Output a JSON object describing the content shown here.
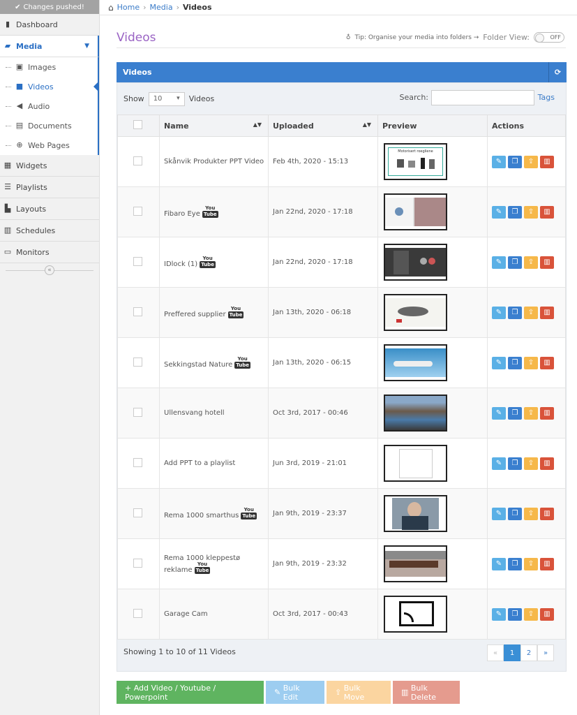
{
  "sidebar": {
    "pushed_label": "Changes pushed!",
    "items": [
      {
        "label": "Dashboard"
      },
      {
        "label": "Media"
      },
      {
        "label": "Widgets"
      },
      {
        "label": "Playlists"
      },
      {
        "label": "Layouts"
      },
      {
        "label": "Schedules"
      },
      {
        "label": "Monitors"
      }
    ],
    "media_sub": [
      {
        "label": "Images"
      },
      {
        "label": "Videos"
      },
      {
        "label": "Audio"
      },
      {
        "label": "Documents"
      },
      {
        "label": "Web Pages"
      }
    ]
  },
  "breadcrumb": {
    "home": "Home",
    "media": "Media",
    "current": "Videos"
  },
  "page": {
    "title": "Videos",
    "tip": "Tip: Organise your media into folders →",
    "folder_view_label": "Folder View:",
    "folder_view_state": "OFF"
  },
  "panel": {
    "title": "Videos",
    "show_label": "Show",
    "page_size": "10",
    "show_suffix": "Videos",
    "search_label": "Search:",
    "tags_link": "Tags",
    "columns": {
      "name": "Name",
      "uploaded": "Uploaded",
      "preview": "Preview",
      "actions": "Actions"
    },
    "rows": [
      {
        "name": "Skånvik Produkter PPT Video",
        "uploaded": "Feb 4th, 2020 - 15:13"
      },
      {
        "name": "Fibaro Eye",
        "uploaded": "Jan 22nd, 2020 - 17:18"
      },
      {
        "name": "IDlock (1)",
        "uploaded": "Jan 22nd, 2020 - 17:18"
      },
      {
        "name": "Preffered supplier",
        "uploaded": "Jan 13th, 2020 - 06:18"
      },
      {
        "name": "Sekkingstad Nature",
        "uploaded": "Jan 13th, 2020 - 06:15"
      },
      {
        "name": "Ullensvang hotell",
        "uploaded": "Oct 3rd, 2017 - 00:46"
      },
      {
        "name": "Add PPT to a playlist",
        "uploaded": "Jun 3rd, 2019 - 21:01"
      },
      {
        "name": "Rema 1000 smarthus",
        "uploaded": "Jan 9th, 2019 - 23:37"
      },
      {
        "name": "Rema 1000 kleppestø reklame",
        "uploaded": "Jan 9th, 2019 - 23:32"
      },
      {
        "name": "Garage Cam",
        "uploaded": "Oct 3rd, 2017 - 00:43"
      }
    ],
    "youtube_you": "You",
    "youtube_tube": "Tube",
    "preview_text": "Motorisert roegliene",
    "info": "Showing 1 to 10 of 11 Videos",
    "pager": {
      "prev": "«",
      "p1": "1",
      "p2": "2",
      "next": "»"
    }
  },
  "buttons": {
    "add": "+ Add Video / Youtube / Powerpoint",
    "bulk_edit": "Bulk Edit",
    "bulk_move": "Bulk Move",
    "bulk_delete": "Bulk Delete"
  }
}
